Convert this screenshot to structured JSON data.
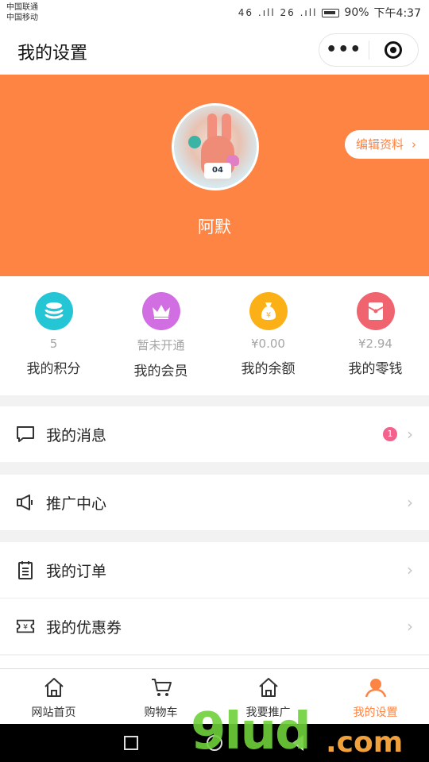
{
  "status_bar": {
    "carrier_1": "中国联通",
    "carrier_2": "中国移动",
    "net": "46 .ıll 26 .ıll",
    "battery": "90%",
    "time": "下午4:37"
  },
  "navbar": {
    "title": "我的设置",
    "more_label": "•••"
  },
  "profile": {
    "nickname": "阿默",
    "edit_label": "编辑资料",
    "edit_arrow": "›",
    "avatar_shirt": "04"
  },
  "stats": [
    {
      "value": "5",
      "label": "我的积分",
      "color": "#24c6d6",
      "icon": "coins-icon"
    },
    {
      "value": "暂未开通",
      "label": "我的会员",
      "color": "#d06ee2",
      "icon": "crown-icon"
    },
    {
      "value": "¥0.00",
      "label": "我的余额",
      "color": "#fbb018",
      "icon": "money-bag-icon"
    },
    {
      "value": "¥2.94",
      "label": "我的零钱",
      "color": "#f0646f",
      "icon": "red-envelope-icon"
    }
  ],
  "menu": {
    "messages": {
      "label": "我的消息",
      "badge": "1",
      "arrow": "›"
    },
    "promotion": {
      "label": "推广中心",
      "arrow": "›"
    },
    "orders": {
      "label": "我的订单",
      "arrow": "›"
    },
    "coupons": {
      "label": "我的优惠券",
      "arrow": "›"
    }
  },
  "tabbar": [
    {
      "label": "网站首页"
    },
    {
      "label": "购物车"
    },
    {
      "label": "我要推广"
    },
    {
      "label": "我的设置"
    }
  ],
  "watermark": {
    "main": "9lud",
    "suffix": ".com"
  },
  "colors": {
    "accent": "#fe8443",
    "badge": "#f2628c"
  }
}
